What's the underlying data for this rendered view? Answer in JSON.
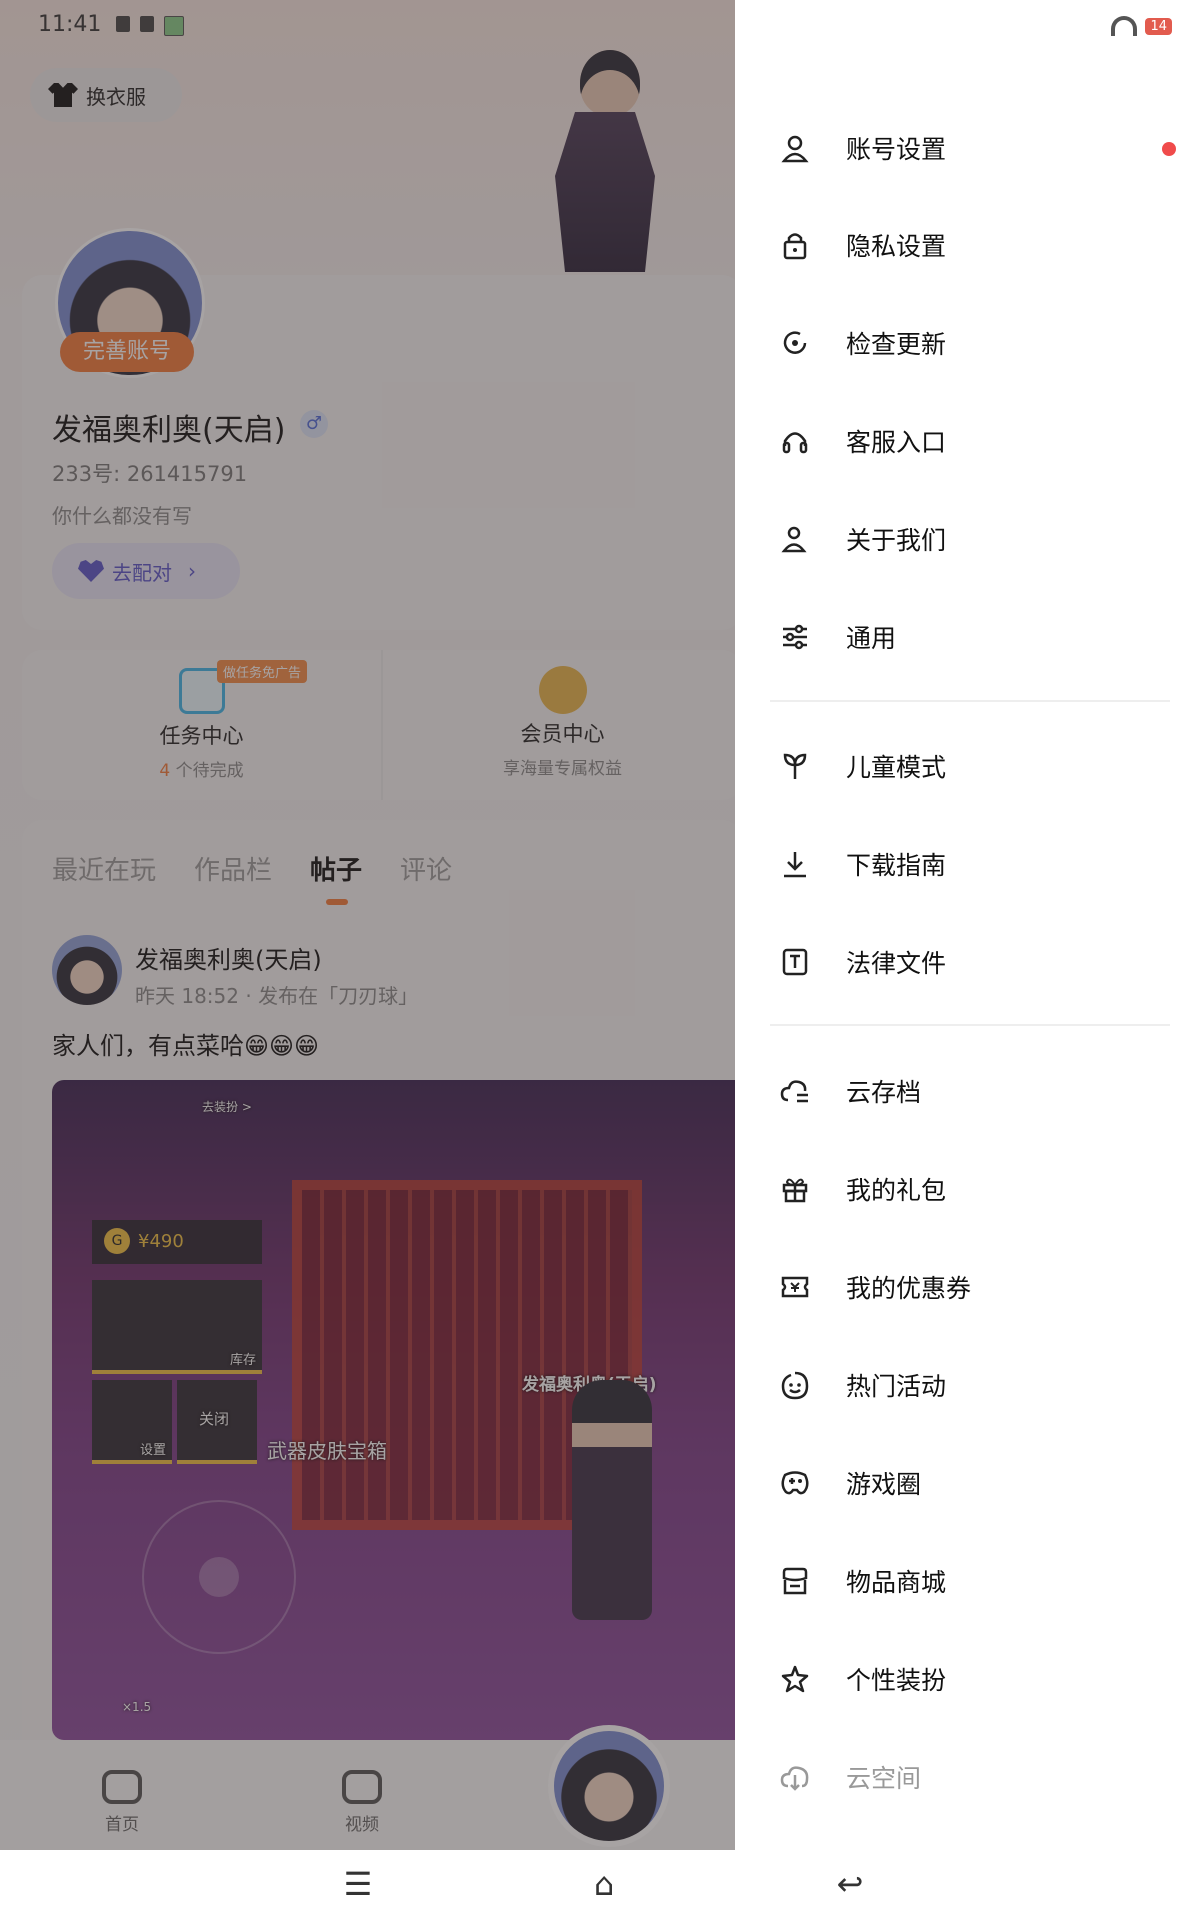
{
  "status": {
    "time": "11:41",
    "battery": "14"
  },
  "profile": {
    "costume_button": "换衣服",
    "perfect_badge": "完善账号",
    "username": "发福奥利奥(天启)",
    "gender_symbol": "♂",
    "uid": "233号: 261415791",
    "bio": "你什么都没有写",
    "match_button": "去配对"
  },
  "tasks": {
    "task_center": {
      "title": "任务中心",
      "count": "4",
      "sub": "个待完成",
      "ad_tag": "做任务免广告"
    },
    "member_center": {
      "title": "会员中心",
      "sub": "享海量专属权益"
    }
  },
  "tabs": [
    "最近在玩",
    "作品栏",
    "帖子",
    "评论"
  ],
  "active_tab": "帖子",
  "post": {
    "user": "发福奥利奥(天启)",
    "time": "昨天 18:52 · 发布在「刀刃球」",
    "text": "家人们，有点菜哈😁😁😁",
    "game": {
      "coins": "¥490",
      "label_weapon_box": "武器皮肤宝箱",
      "label_player": "发福奥利奥(天启)",
      "label_inventory": "库存",
      "label_settings": "设置",
      "label_close": "关闭",
      "label_multiplier": "×1.5",
      "label_top": "去装扮 >"
    }
  },
  "bottom_nav": [
    {
      "label": "首页",
      "icon": "gamepad-icon"
    },
    {
      "label": "视频",
      "icon": "video-icon"
    }
  ],
  "drawer": {
    "group1": [
      {
        "label": "账号设置",
        "icon": "user-icon",
        "dot": true
      },
      {
        "label": "隐私设置",
        "icon": "lock-icon"
      },
      {
        "label": "检查更新",
        "icon": "refresh-icon"
      },
      {
        "label": "客服入口",
        "icon": "headset-icon"
      },
      {
        "label": "关于我们",
        "icon": "person-info-icon"
      },
      {
        "label": "通用",
        "icon": "sliders-icon"
      }
    ],
    "group2": [
      {
        "label": "儿童模式",
        "icon": "sprout-icon"
      },
      {
        "label": "下载指南",
        "icon": "download-icon"
      },
      {
        "label": "法律文件",
        "icon": "document-t-icon"
      }
    ],
    "group3": [
      {
        "label": "云存档",
        "icon": "cloud-save-icon"
      },
      {
        "label": "我的礼包",
        "icon": "gift-icon"
      },
      {
        "label": "我的优惠券",
        "icon": "coupon-icon"
      },
      {
        "label": "热门活动",
        "icon": "smile-icon"
      },
      {
        "label": "游戏圈",
        "icon": "game-circle-icon"
      },
      {
        "label": "物品商城",
        "icon": "store-icon"
      },
      {
        "label": "个性装扮",
        "icon": "star-dress-icon"
      },
      {
        "label": "云空间",
        "icon": "cloud-space-icon"
      }
    ]
  }
}
